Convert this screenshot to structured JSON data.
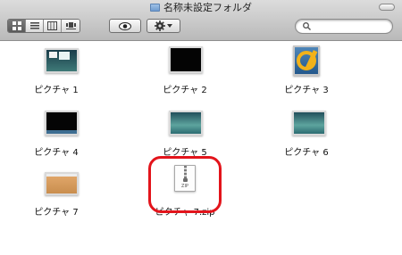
{
  "window": {
    "title": "名称未設定フォルダ"
  },
  "toolbar": {
    "view_buttons": [
      "icon-view",
      "list-view",
      "column-view",
      "coverflow-view"
    ],
    "quicklook_icon": "eye-icon",
    "action_icon": "gear-icon",
    "search_placeholder": ""
  },
  "files": [
    {
      "name": "ピクチャ 1",
      "thumb": "desktop-screenshot"
    },
    {
      "name": "ピクチャ 2",
      "thumb": "black-screenshot"
    },
    {
      "name": "ピクチャ 3",
      "thumb": "xcode-icon"
    },
    {
      "name": "ピクチャ 4",
      "thumb": "black-screenshot-with-dock"
    },
    {
      "name": "ピクチャ 5",
      "thumb": "aurora-screenshot"
    },
    {
      "name": "ピクチャ 6",
      "thumb": "aurora-screenshot"
    },
    {
      "name": "ピクチャ 7",
      "thumb": "sand-screenshot"
    },
    {
      "name": "ピクチャ 7.zip",
      "thumb": "zip-archive-icon",
      "badge": "ZIP"
    }
  ],
  "colors": {
    "highlight_ring": "#e3141b"
  }
}
